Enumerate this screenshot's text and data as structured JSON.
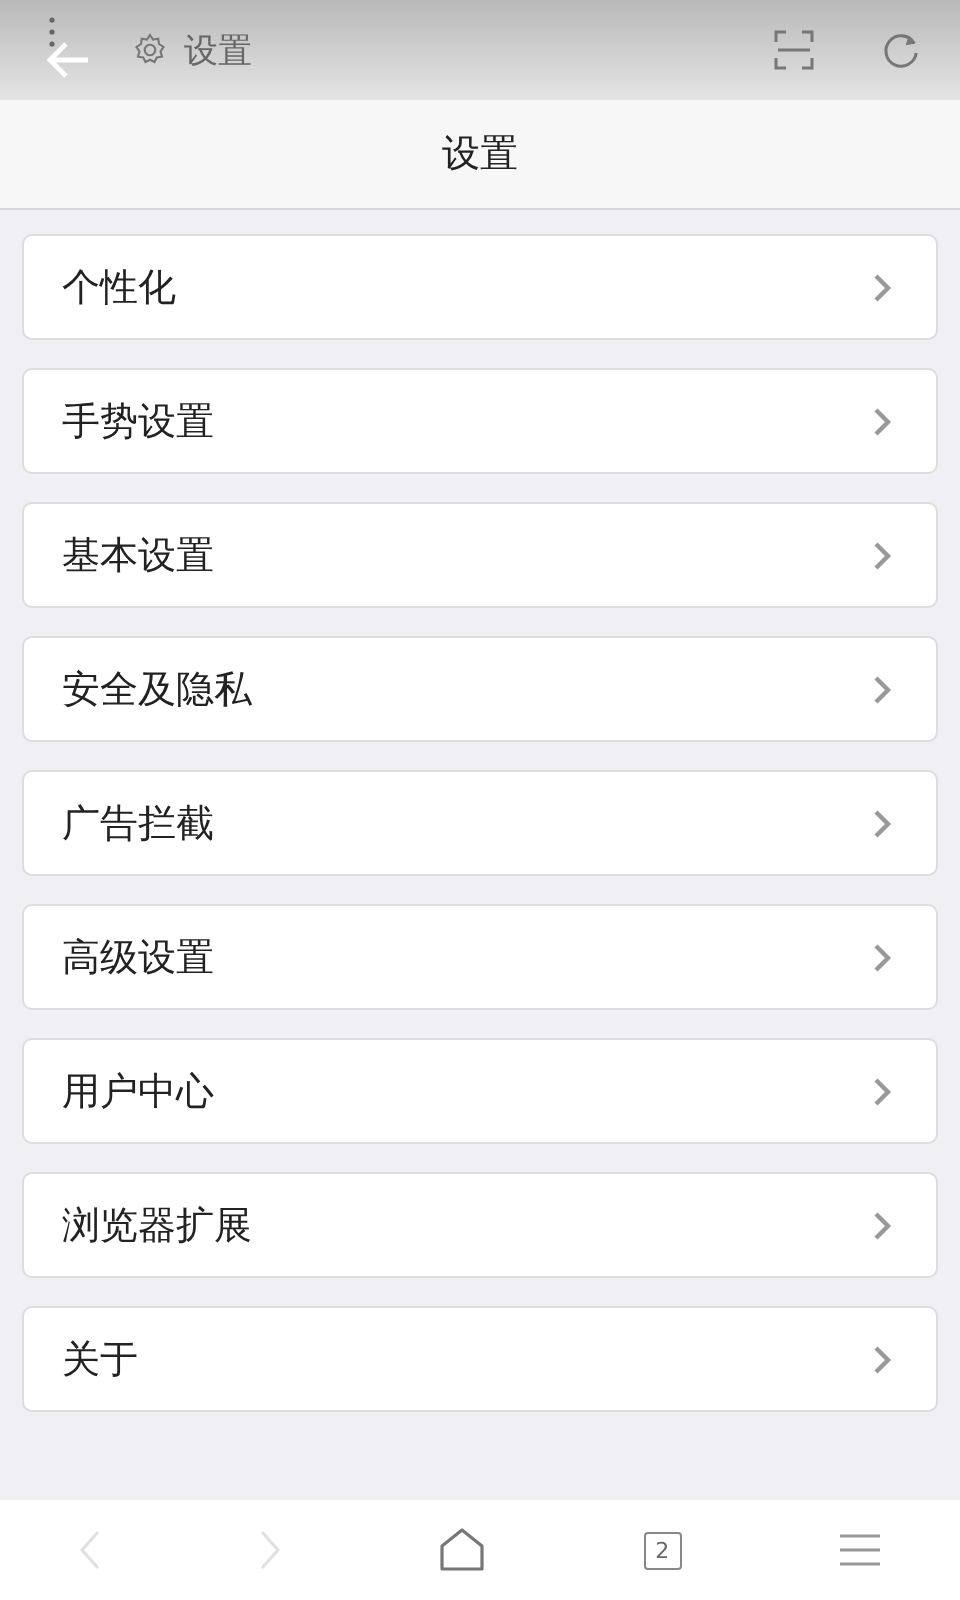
{
  "address_bar": {
    "title": "设置"
  },
  "header": {
    "title": "设置"
  },
  "menu_items": [
    {
      "label": "个性化"
    },
    {
      "label": "手势设置"
    },
    {
      "label": "基本设置"
    },
    {
      "label": "安全及隐私"
    },
    {
      "label": "广告拦截"
    },
    {
      "label": "高级设置"
    },
    {
      "label": "用户中心"
    },
    {
      "label": "浏览器扩展"
    },
    {
      "label": "关于"
    }
  ],
  "bottom_bar": {
    "back_disabled": true,
    "forward_disabled": true,
    "tab_count": "2"
  }
}
